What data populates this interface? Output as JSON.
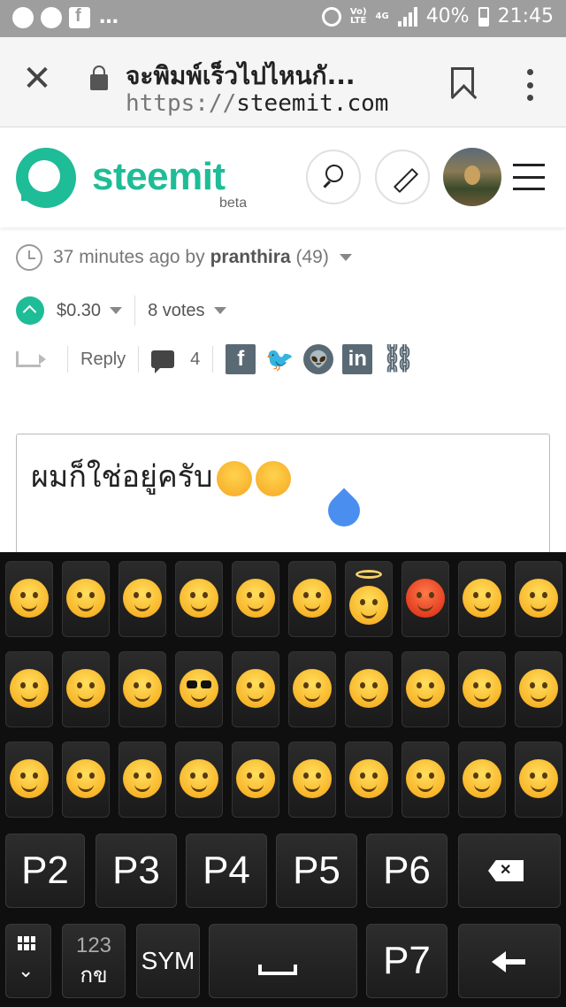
{
  "status_bar": {
    "network_top": "Vo)",
    "network_bottom": "LTE",
    "signal_top": "4G",
    "battery": "40%",
    "time": "21:45"
  },
  "browser": {
    "tab_title": "จะพิมพ์เร็วไปไหนกั...",
    "url_protocol": "https://",
    "url_host": "steemit.com"
  },
  "site": {
    "logo_text": "steemit",
    "logo_sub": "beta",
    "brand_color": "#1ebc97"
  },
  "post": {
    "time_ago": "37 minutes ago by",
    "author": "pranthira",
    "reputation": "(49)",
    "payout": "$0.30",
    "votes": "8 votes",
    "reply_label": "Reply",
    "comment_count": "4"
  },
  "reply_box": {
    "text": "ผมก็ใช่อยู่ครับ"
  },
  "keyboard": {
    "page_keys": [
      "P2",
      "P3",
      "P4",
      "P5",
      "P6",
      "P7"
    ],
    "mode_key_top": "123",
    "mode_key_bottom": "กข",
    "sym_key": "SYM"
  }
}
